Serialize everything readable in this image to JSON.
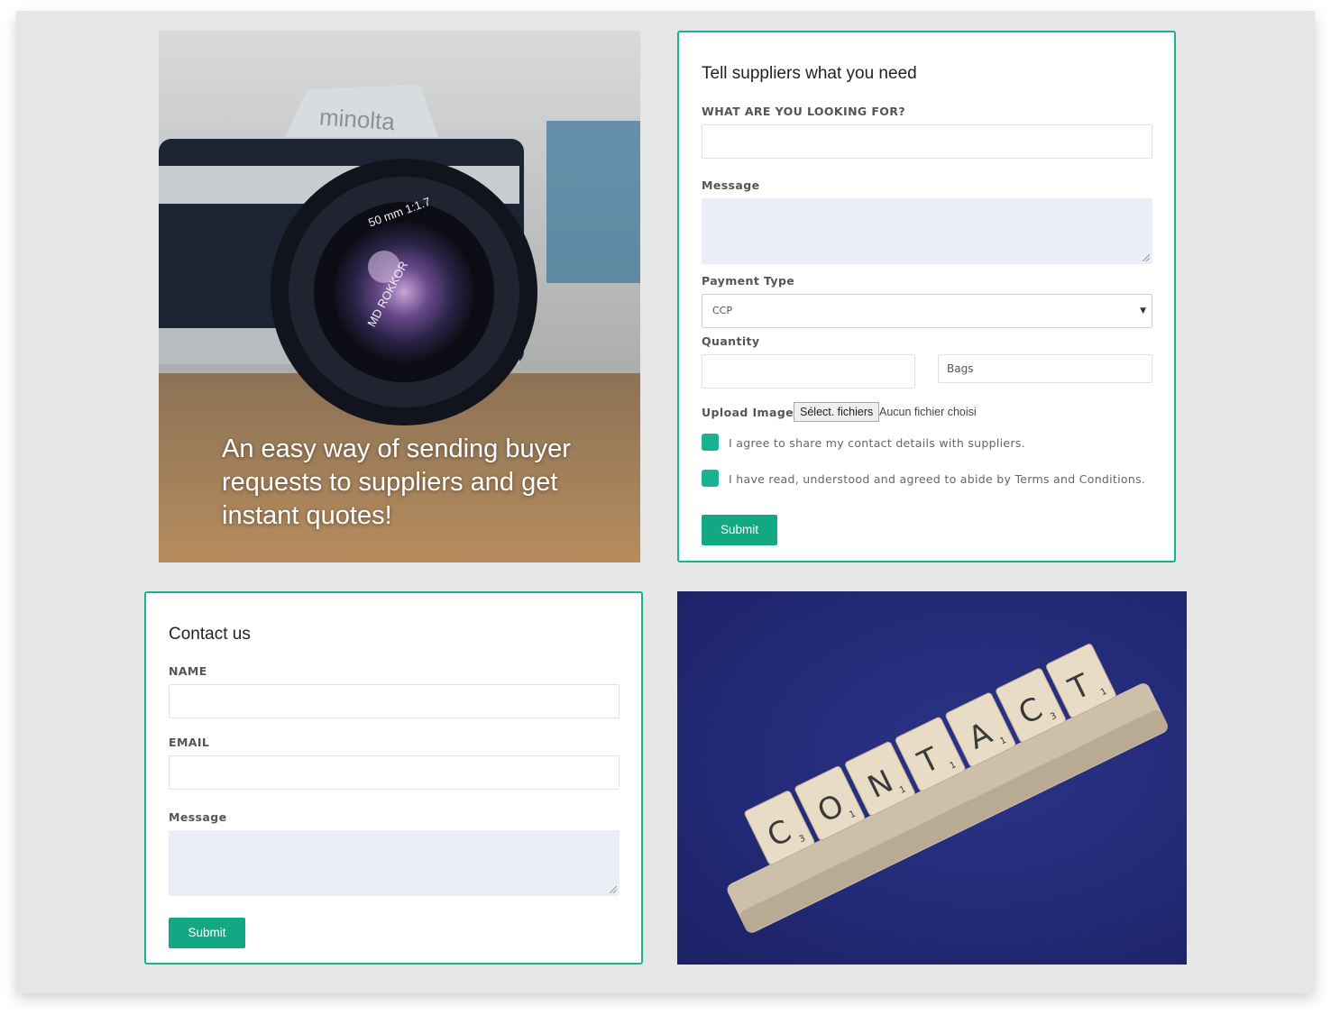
{
  "hero": {
    "caption": "An easy way of sending buyer requests to suppliers and get instant quotes!",
    "brand_text": "minolta",
    "lens_text": "MD ROKKOR",
    "lens_spec": "50 mm 1:1.7"
  },
  "request_form": {
    "title": "Tell suppliers what you need",
    "looking_for_label": "WHAT ARE YOU LOOKING FOR?",
    "looking_for_value": "",
    "message_label": "Message",
    "payment_label": "Payment Type",
    "payment_value": "CCP",
    "quantity_label": "Quantity",
    "quantity_value": "",
    "quantity_unit": "Bags",
    "upload_label": "Upload Images",
    "file_button": "Sélect. fichiers",
    "file_status": "Aucun fichier choisi",
    "agree_share": "I agree to share my contact details with suppliers.",
    "agree_terms": "I have read, understood and agreed to abide by Terms and Conditions.",
    "submit": "Submit"
  },
  "contact_form": {
    "title": "Contact us",
    "name_label": "NAME",
    "email_label": "EMAIL",
    "message_label": "Message",
    "submit": "Submit"
  },
  "contact_image": {
    "tiles": [
      "C",
      "O",
      "N",
      "T",
      "A",
      "C",
      "T"
    ],
    "tile_scores": [
      "3",
      "1",
      "1",
      "1",
      "1",
      "3",
      "1"
    ]
  },
  "colors": {
    "accent": "#19b393",
    "button": "#13a884",
    "textarea_bg": "#ebedf7",
    "page_bg": "#e6e6e6"
  }
}
